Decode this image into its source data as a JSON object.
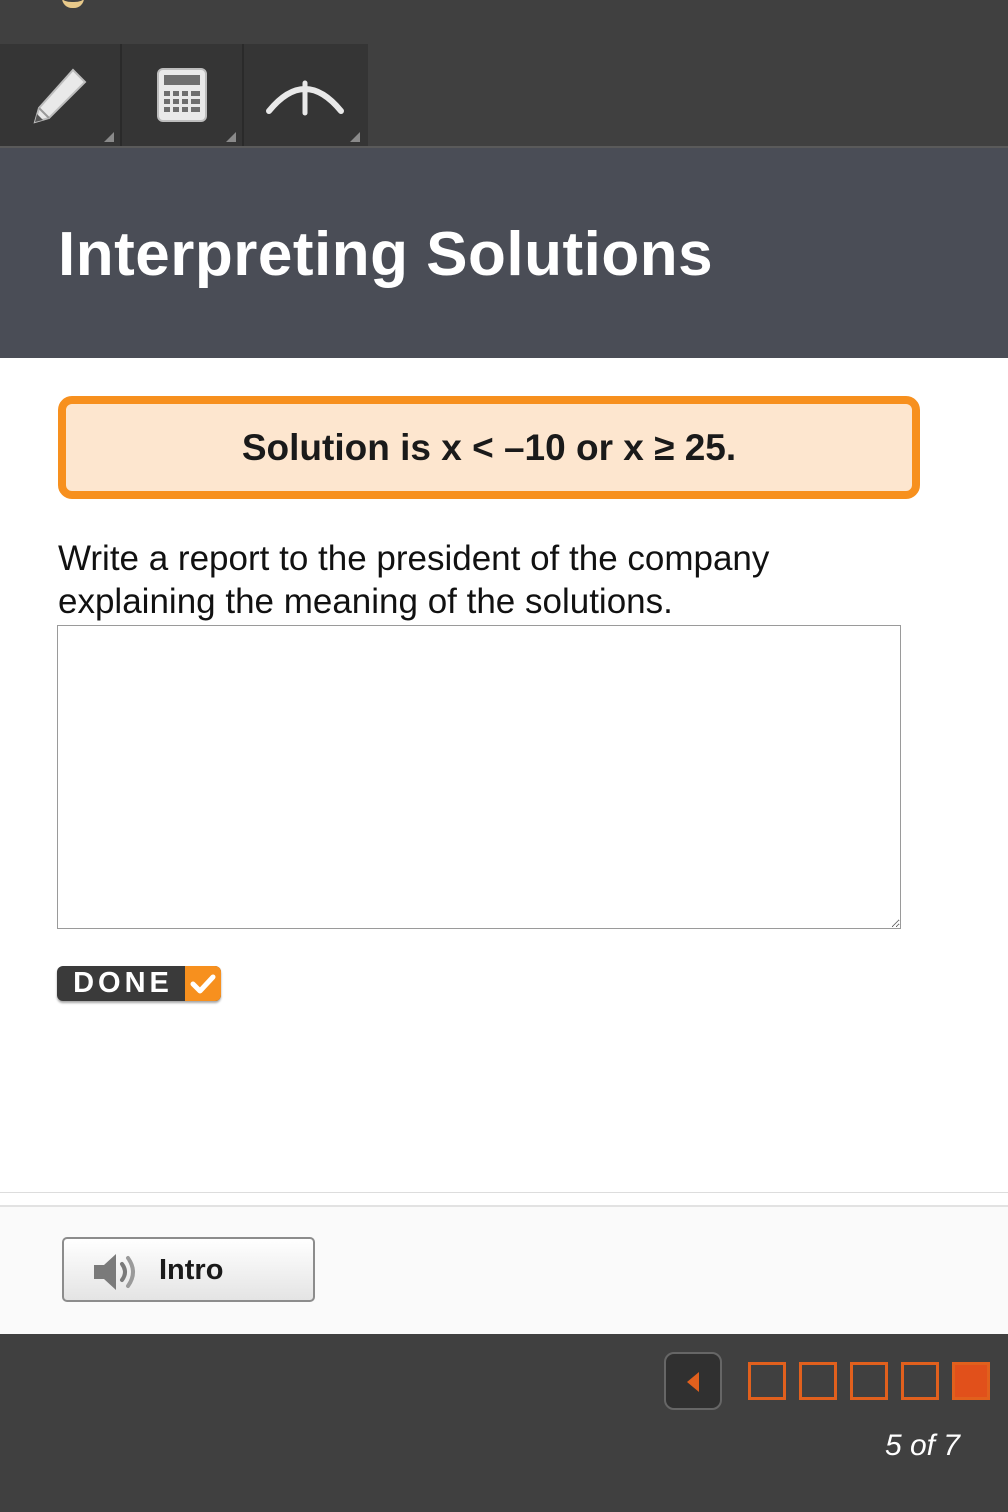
{
  "toolbar": {
    "tools": [
      {
        "icon": "pencil-icon"
      },
      {
        "icon": "calculator-icon"
      },
      {
        "icon": "graph-icon"
      }
    ]
  },
  "lesson": {
    "title": "Interpreting Solutions"
  },
  "solution": {
    "text": "Solution is x < –10 or x ≥ 25."
  },
  "prompt": {
    "text": "Write a report to the president of the company explaining the meaning of the solutions."
  },
  "answer": {
    "value": "",
    "placeholder": ""
  },
  "done_button": {
    "label": "DONE"
  },
  "intro_button": {
    "label": "Intro",
    "icon": "speaker-icon"
  },
  "pager": {
    "label": "5 of 7",
    "current": 5,
    "total": 7
  },
  "colors": {
    "accent": "#f7901e",
    "title_band": "#4a4d56",
    "bar": "#404040",
    "solution_fill": "#fde6cf",
    "page_current": "#e1501b"
  }
}
